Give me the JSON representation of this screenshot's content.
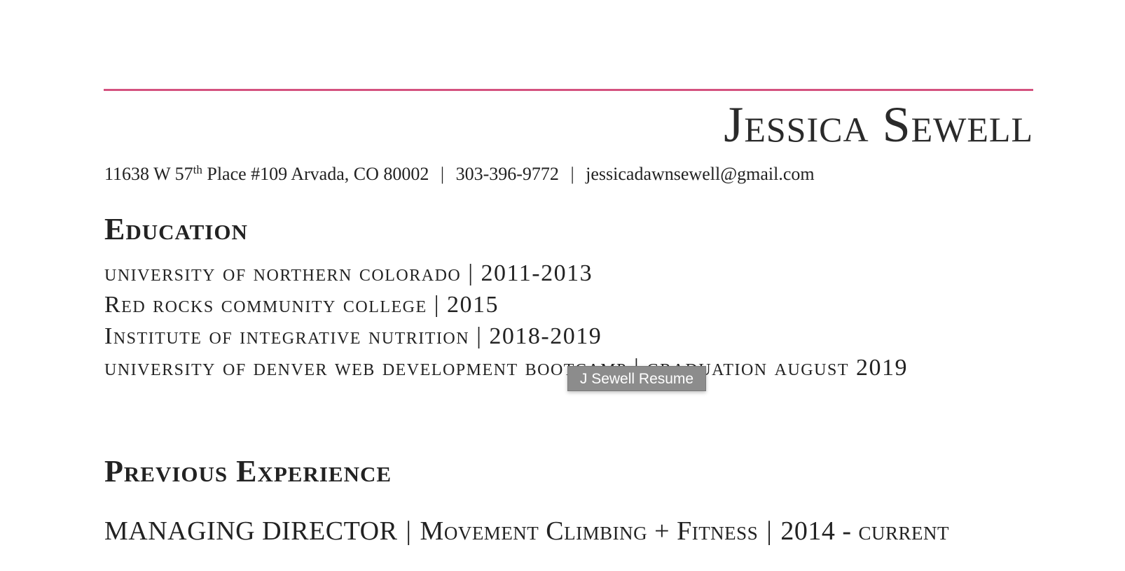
{
  "resume": {
    "name": "Jessica Sewell",
    "contact": {
      "address_prefix": "11638 W 57",
      "address_superscript": "th",
      "address_suffix": " Place #109 Arvada, CO 80002",
      "separator": "|",
      "phone": "303-396-9772",
      "email": "jessicadawnsewell@gmail.com"
    },
    "accent_color": "#d4527f",
    "sections": {
      "education": {
        "title": "Education",
        "items": [
          {
            "school": "university of northern colorado",
            "separator": "|",
            "date": "2011-2013"
          },
          {
            "school": "Red rocks community college",
            "separator": "|",
            "date": "2015"
          },
          {
            "school": "Institute of integrative nutrition",
            "separator": "|",
            "date": "2018-2019"
          },
          {
            "school": "university of denver web development bootcamp",
            "separator": "|",
            "date": "graduation august 2019"
          }
        ]
      },
      "experience": {
        "title": "Previous Experience",
        "jobs": [
          {
            "role": "MANAGING DIRECTOR",
            "separator": "|",
            "company": "Movement Climbing + Fitness",
            "dates": "2014 - current"
          }
        ]
      }
    }
  },
  "tooltip": {
    "text": "J Sewell Resume"
  }
}
